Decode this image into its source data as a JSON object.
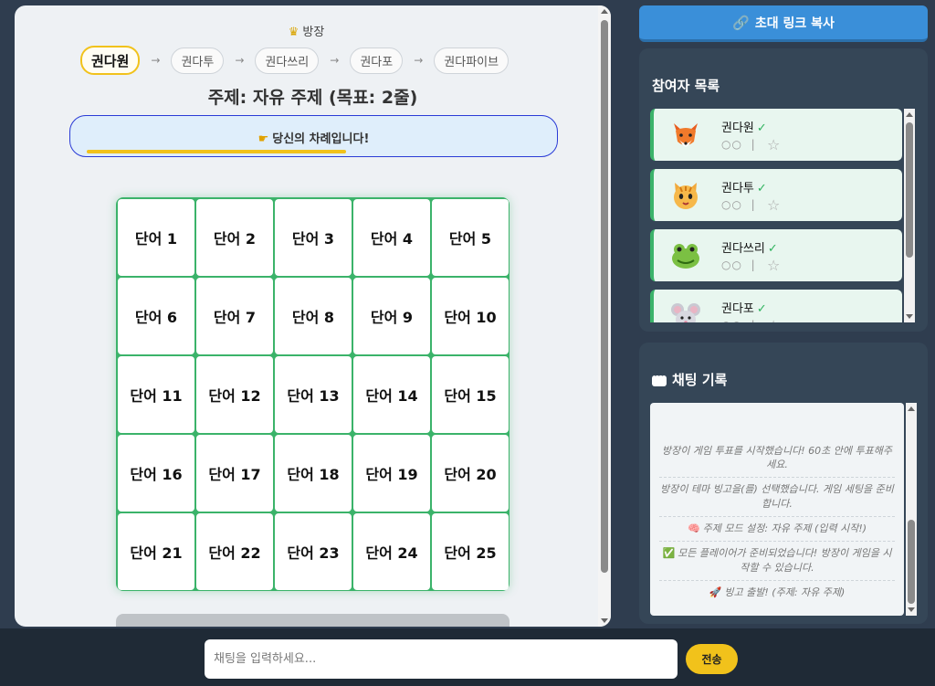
{
  "host": {
    "icon": "crown-icon",
    "label": "방장"
  },
  "turn_order": {
    "players": [
      {
        "name": "권다원",
        "active": true
      },
      {
        "name": "권다투",
        "active": false
      },
      {
        "name": "권다쓰리",
        "active": false
      },
      {
        "name": "권다포",
        "active": false
      },
      {
        "name": "권다파이브",
        "active": false
      }
    ],
    "separator": "→"
  },
  "topic": "주제: 자유 주제 (목표: 2줄)",
  "turn_banner": {
    "icon": "pointing-hand-icon",
    "text": "당신의 차례입니다!",
    "timer_progress": 0.55
  },
  "board": {
    "cells": [
      "단어 1",
      "단어 2",
      "단어 3",
      "단어 4",
      "단어 5",
      "단어 6",
      "단어 7",
      "단어 8",
      "단어 9",
      "단어 10",
      "단어 11",
      "단어 12",
      "단어 13",
      "단어 14",
      "단어 15",
      "단어 16",
      "단어 17",
      "단어 18",
      "단어 19",
      "단어 20",
      "단어 21",
      "단어 22",
      "단어 23",
      "단어 24",
      "단어 25"
    ]
  },
  "invite_button": {
    "icon": "link-icon",
    "label": "초대 링크 복사"
  },
  "participants": {
    "title": "참여자 목록",
    "items": [
      {
        "name": "권다원",
        "avatar": "fox-icon",
        "ready": "✓",
        "dots": "○○",
        "divider": "|"
      },
      {
        "name": "권다투",
        "avatar": "cat-icon",
        "ready": "✓",
        "dots": "○○",
        "divider": "|"
      },
      {
        "name": "권다쓰리",
        "avatar": "frog-icon",
        "ready": "✓",
        "dots": "○○",
        "divider": "|"
      },
      {
        "name": "권다포",
        "avatar": "mouse-icon",
        "ready": "✓",
        "dots": "○○",
        "divider": "|"
      }
    ]
  },
  "chat": {
    "title": "채팅 기록",
    "messages": [
      {
        "emoji": "",
        "text": "방장이 게임 투표를 시작했습니다! 60초 안에 투표해주세요."
      },
      {
        "emoji": "",
        "text": "방장이 테마 빙고을(를) 선택했습니다. 게임 세팅을 준비합니다."
      },
      {
        "emoji": "🧠",
        "text": "주제 모드 설정: 자유 주제 (입력 시작!)"
      },
      {
        "emoji": "✅",
        "text": "모든 플레이어가 준비되었습니다! 방장이 게임을 시작할 수 있습니다."
      },
      {
        "emoji": "🚀",
        "text": "빙고 출발! (주제: 자유 주제)"
      }
    ]
  },
  "chat_bar": {
    "placeholder": "채팅을 입력하세요...",
    "send_label": "전송"
  },
  "colors": {
    "accent_yellow": "#f1c21b",
    "board_green": "#3bb36a",
    "invite_blue": "#3a8fd9",
    "panel_dark": "#354657"
  }
}
